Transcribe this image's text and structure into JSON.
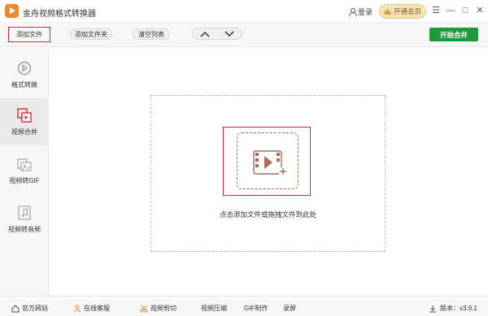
{
  "window": {
    "title": "金舟视频格式转换器",
    "login_label": "登录",
    "vip_label": "开通会员",
    "controls": [
      "☰",
      "—",
      "□",
      "✕"
    ]
  },
  "toolbar": {
    "add_file_label": "添加文件",
    "add_folder_label": "添加文件夹",
    "clear_list_label": "清空列表",
    "move_up_icon": "chevron-up",
    "move_down_icon": "chevron-down",
    "start_label": "开始合并"
  },
  "sidebar": {
    "items": [
      {
        "label": "格式转换",
        "icon": "format-convert-icon",
        "active": false
      },
      {
        "label": "视频合并",
        "icon": "video-merge-icon",
        "active": true
      },
      {
        "label": "视频转GIF",
        "icon": "video-to-gif-icon",
        "active": false
      },
      {
        "label": "视频转音频",
        "icon": "video-to-audio-icon",
        "active": false
      }
    ]
  },
  "main": {
    "drop_hint": "点击添加文件或拖拽文件到此处"
  },
  "footer": {
    "items": [
      {
        "label": "官方网站",
        "icon": "home-icon"
      },
      {
        "label": "在线客服",
        "icon": "support-icon"
      },
      {
        "label": "视频剪切",
        "icon": "scissors-icon"
      },
      {
        "label": "视频压缩",
        "icon": ""
      },
      {
        "label": "GIF制作",
        "icon": ""
      },
      {
        "label": "录屏",
        "icon": ""
      }
    ],
    "version_label": "版本：v3.9.1"
  },
  "colors": {
    "accent_red": "#d9282f",
    "start_green": "#1d9b3c",
    "logo_orange": "#f08a2a",
    "icon_brown": "#b06a5a"
  }
}
